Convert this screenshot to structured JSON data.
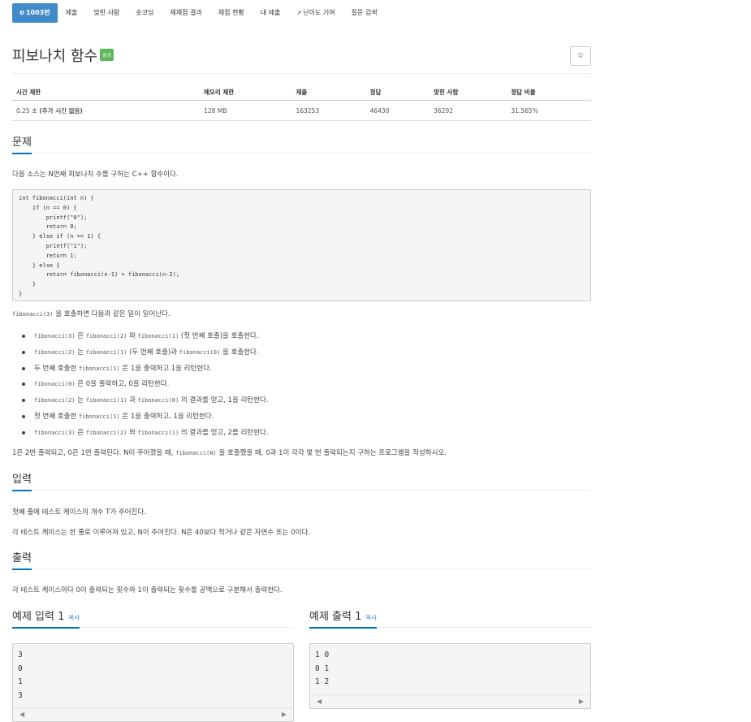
{
  "nav": {
    "problem_number": "1003번",
    "tabs": [
      "제출",
      "맞힌 사람",
      "숏코딩",
      "재채점 결과",
      "채점 현황",
      "내 제출",
      "난이도 기여",
      "질문 검색"
    ]
  },
  "title": "피보나치 함수",
  "badge": "성공",
  "star": "☆",
  "info_table": {
    "headers": [
      "시간 제한",
      "메모리 제한",
      "제출",
      "정답",
      "맞힌 사람",
      "정답 비율"
    ],
    "time_value": "0.25 초",
    "time_extra": "(추가 시간 없음)",
    "memory": "128 MB",
    "submissions": "163253",
    "accepted": "46430",
    "solvers": "36292",
    "ratio": "31.565%"
  },
  "problem": {
    "heading": "문제",
    "intro": "다음 소스는 N번째 피보나치 수를 구하는 C++ 함수이다.",
    "code": "int fibonacci(int n) {\n    if (n == 0) {\n        printf(\"0\");\n        return 0;\n    } else if (n == 1) {\n        printf(\"1\");\n        return 1;\n    } else {\n        return fibonacci(n‐1) + fibonacci(n‐2);\n    }\n}",
    "call_code": "fibonacci(3)",
    "call_text": " 을 호출하면 다음과 같은 일이 일어난다.",
    "steps": [
      [
        [
          "c",
          "fibonacci(3)"
        ],
        [
          "t",
          " 은 "
        ],
        [
          "c",
          "fibonacci(2)"
        ],
        [
          "t",
          " 와 "
        ],
        [
          "c",
          "fibonacci(1)"
        ],
        [
          "t",
          " (첫 번째 호출)을 호출한다."
        ]
      ],
      [
        [
          "c",
          "fibonacci(2)"
        ],
        [
          "t",
          " 는 "
        ],
        [
          "c",
          "fibonacci(1)"
        ],
        [
          "t",
          " (두 번째 호출)과 "
        ],
        [
          "c",
          "fibonacci(0)"
        ],
        [
          "t",
          " 을 호출한다."
        ]
      ],
      [
        [
          "t",
          "두 번째 호출한 "
        ],
        [
          "c",
          "fibonacci(1)"
        ],
        [
          "t",
          " 은 1을 출력하고 1을 리턴한다."
        ]
      ],
      [
        [
          "c",
          "fibonacci(0)"
        ],
        [
          "t",
          " 은 0을 출력하고, 0을 리턴한다."
        ]
      ],
      [
        [
          "c",
          "fibonacci(2)"
        ],
        [
          "t",
          " 는 "
        ],
        [
          "c",
          "fibonacci(1)"
        ],
        [
          "t",
          " 과 "
        ],
        [
          "c",
          "fibonacci(0)"
        ],
        [
          "t",
          " 의 결과를 얻고, 1을 리턴한다."
        ]
      ],
      [
        [
          "t",
          "첫 번째 호출한 "
        ],
        [
          "c",
          "fibonacci(1)"
        ],
        [
          "t",
          " 은 1을 출력하고, 1을 리턴한다."
        ]
      ],
      [
        [
          "c",
          "fibonacci(3)"
        ],
        [
          "t",
          " 은 "
        ],
        [
          "c",
          "fibonacci(2)"
        ],
        [
          "t",
          " 와 "
        ],
        [
          "c",
          "fibonacci(1)"
        ],
        [
          "t",
          " 의 결과를 얻고, 2를 리턴한다."
        ]
      ]
    ],
    "summary_pre": "1은 2번 출력되고, 0은 1번 출력된다. N이 주어졌을 때, ",
    "summary_code": "fibonacci(N)",
    "summary_post": " 을 호출했을 때, 0과 1이 각각 몇 번 출력되는지 구하는 프로그램을 작성하시오."
  },
  "input": {
    "heading": "입력",
    "line1": "첫째 줄에 테스트 케이스의 개수 T가 주어진다.",
    "line2": "각 테스트 케이스는 한 줄로 이루어져 있고, N이 주어진다. N은 40보다 작거나 같은 자연수 또는 0이다."
  },
  "output": {
    "heading": "출력",
    "line1": "각 테스트 케이스마다 0이 출력되는 횟수와 1이 출력되는 횟수를 공백으로 구분해서 출력한다."
  },
  "sample_input": {
    "heading": "예제 입력 1",
    "copy": "복사",
    "content": "3\n0\n1\n3"
  },
  "sample_output": {
    "heading": "예제 출력 1",
    "copy": "복사",
    "content": "1 0\n0 1\n1 2"
  },
  "scroll": {
    "left": "◀",
    "right": "▶"
  }
}
